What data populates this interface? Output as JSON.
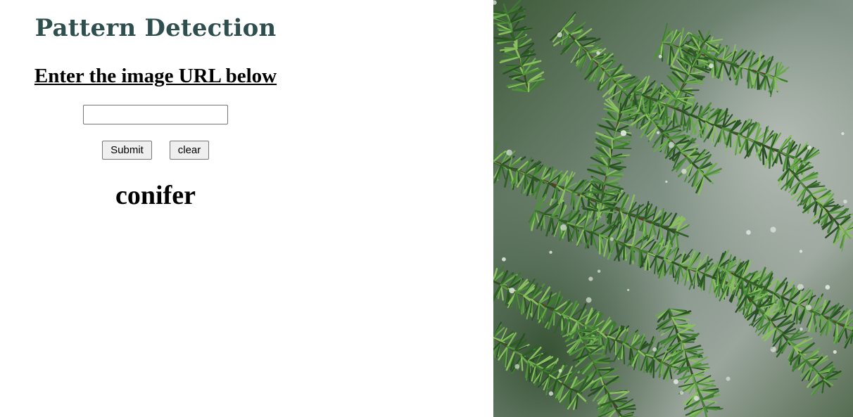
{
  "header": {
    "title": "Pattern Detection",
    "title_color": "#2f4f4f"
  },
  "form": {
    "instruction": "Enter the image URL below",
    "url_input": {
      "value": "",
      "placeholder": ""
    },
    "submit_label": "Submit",
    "clear_label": "clear"
  },
  "result": {
    "label": "conifer"
  },
  "image": {
    "subject": "conifer branch with water droplets",
    "dominant_color": "#3d6b34"
  }
}
